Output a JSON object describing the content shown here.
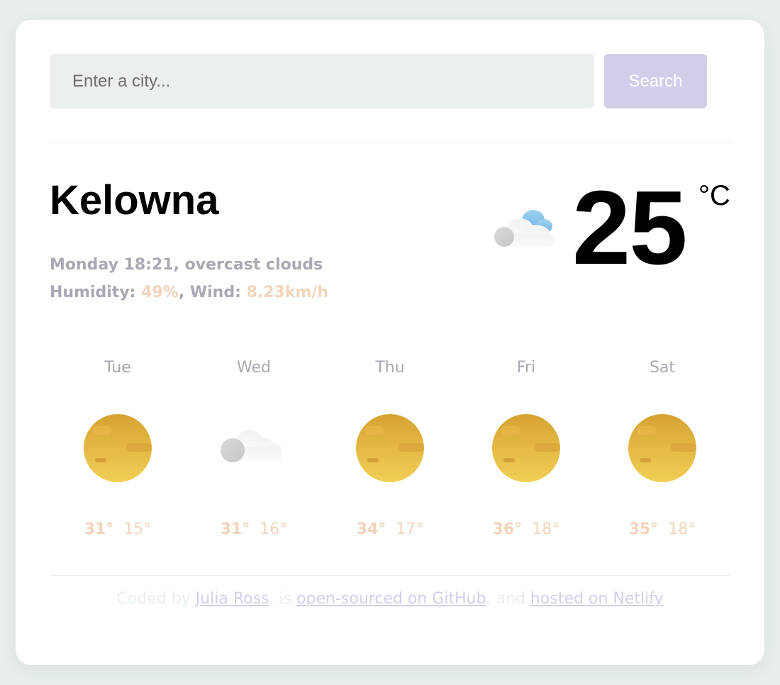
{
  "search": {
    "placeholder": "Enter a city...",
    "button_label": "Search"
  },
  "current": {
    "city": "Kelowna",
    "day_time": "Monday 18:21",
    "description": "overcast clouds",
    "humidity_label": "Humidity: ",
    "humidity_value": "49%",
    "wind_label": ", Wind: ",
    "wind_value": "8.23km/h",
    "temperature": "25",
    "unit": "°C",
    "icon": "cloud-sun-icon"
  },
  "forecast": [
    {
      "day": "Tue",
      "max": "31°",
      "min": "15°",
      "icon": "sun-icon"
    },
    {
      "day": "Wed",
      "max": "31°",
      "min": "16°",
      "icon": "cloud-icon"
    },
    {
      "day": "Thu",
      "max": "34°",
      "min": "17°",
      "icon": "sun-icon"
    },
    {
      "day": "Fri",
      "max": "36°",
      "min": "18°",
      "icon": "sun-icon"
    },
    {
      "day": "Sat",
      "max": "35°",
      "min": "18°",
      "icon": "sun-icon"
    }
  ],
  "footer": {
    "text_1": "Coded by ",
    "author_link": "Julia Ross",
    "text_2": ", is ",
    "github_link": "open-sourced on GitHub",
    "text_3": ", and ",
    "netlify_link": "hosted on Netlify"
  },
  "colors": {
    "accent": "#f1d4ba",
    "button": "#d3cdea",
    "muted_text": "#a9a8b3",
    "input_bg": "#ebf0ee",
    "page_bg": "#e7eeec"
  }
}
